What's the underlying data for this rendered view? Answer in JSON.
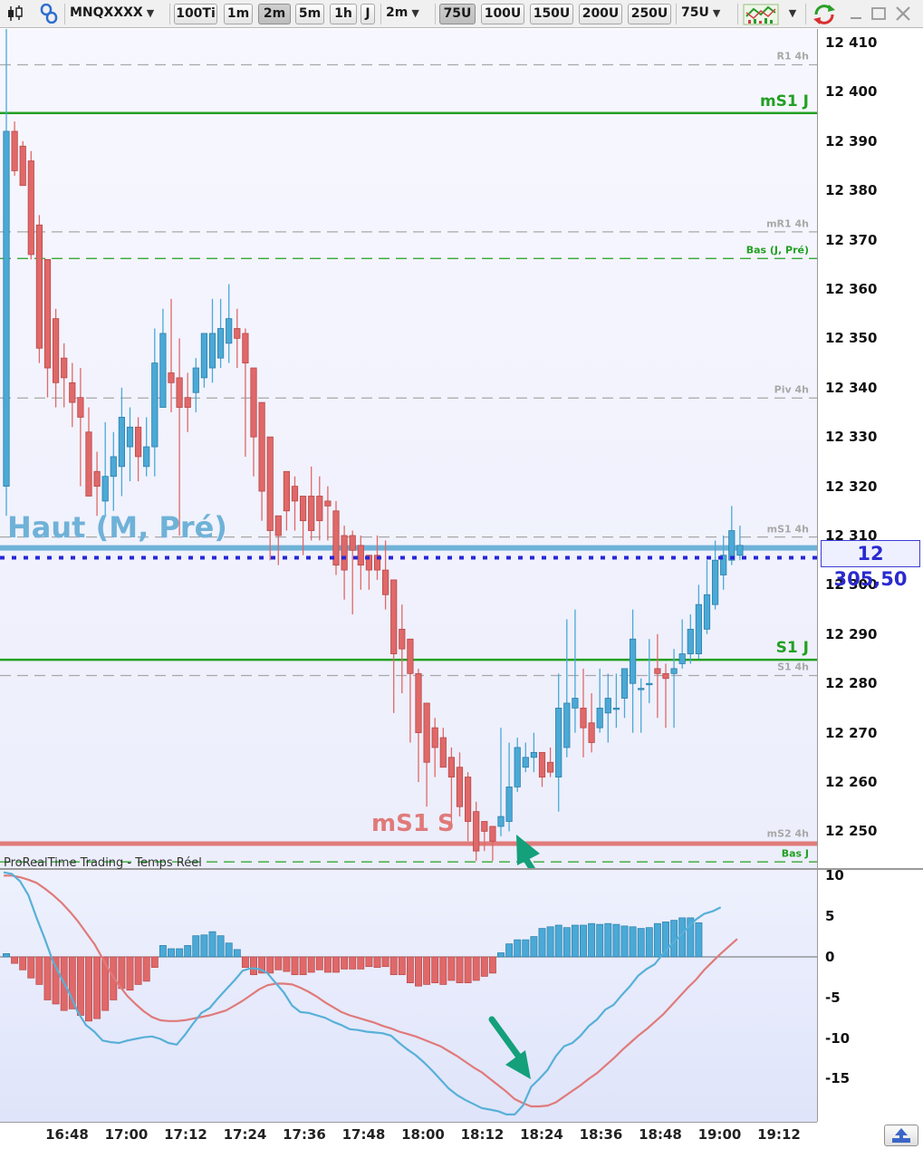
{
  "toolbar": {
    "symbol": "MNQXXXX",
    "tick_btn": "100Ti",
    "timeframes": [
      "1m",
      "2m",
      "5m",
      "1h",
      "J"
    ],
    "active_timeframe": "2m",
    "interval_select": "2m",
    "units": [
      "75U",
      "100U",
      "150U",
      "200U",
      "250U"
    ],
    "active_unit": "75U",
    "units_select": "75U"
  },
  "price_axis": {
    "labels": [
      "12 410",
      "12 400",
      "12 390",
      "12 380",
      "12 370",
      "12 360",
      "12 350",
      "12 340",
      "12 330",
      "12 320",
      "12 310",
      "12 300",
      "12 290",
      "12 280",
      "12 270",
      "12 260",
      "12 250"
    ],
    "values": [
      12410,
      12400,
      12390,
      12380,
      12370,
      12360,
      12350,
      12340,
      12330,
      12320,
      12310,
      12300,
      12290,
      12280,
      12270,
      12260,
      12250
    ],
    "last_price": "12 305,50"
  },
  "levels": [
    {
      "label": "R1 4h",
      "value": 12405.5,
      "style": "dashed",
      "color": "#a8a8a8"
    },
    {
      "label": "mS1 J",
      "value": 12395.7,
      "style": "solid",
      "color": "#22a022"
    },
    {
      "label": "mR1 4h",
      "value": 12371.6,
      "style": "dashed",
      "color": "#a8a8a8"
    },
    {
      "label": "Bas (J, Pré)",
      "value": 12366.2,
      "style": "dashed",
      "color": "#22a022"
    },
    {
      "label": "Piv 4h",
      "value": 12337.9,
      "style": "dashed",
      "color": "#a8a8a8"
    },
    {
      "label": "mS1 4h",
      "value": 12309.7,
      "style": "dashed",
      "color": "#a8a8a8"
    },
    {
      "label": "S1 J",
      "value": 12284.8,
      "style": "solid",
      "color": "#22a022"
    },
    {
      "label": "S1 4h",
      "value": 12281.6,
      "style": "dashed",
      "color": "#a8a8a8"
    },
    {
      "label": "mS2 4h",
      "value": 12247.8,
      "style": "dashed",
      "color": "#a8a8a8"
    },
    {
      "label": "Bas J",
      "value": 12243.8,
      "style": "dashed",
      "color": "#22a022"
    }
  ],
  "annotations": {
    "haut_label": "Haut (M, Pré)",
    "haut_value": 12307.5,
    "ms1s_label": "mS1 S",
    "ms1s_value": 12247.5,
    "current_price_value": 12305.5
  },
  "indicator": {
    "title": "ProRealTime Trading - Temps Réel",
    "axis_labels": [
      "10",
      "5",
      "0",
      "-5",
      "-10",
      "-15"
    ],
    "axis_values": [
      10,
      5,
      0,
      -5,
      -10,
      -15
    ]
  },
  "time_axis": [
    "16:48",
    "17:00",
    "17:12",
    "17:24",
    "17:36",
    "17:48",
    "18:00",
    "18:12",
    "18:24",
    "18:36",
    "18:48",
    "19:00",
    "19:12"
  ],
  "colors": {
    "bull": "#4aa9d6",
    "bear": "#e06868",
    "level_green": "#22a022",
    "level_grey": "#a8a8a8",
    "haut_line": "#6fb2d8",
    "ms1s_line": "#e07a7a",
    "price_dots": "#2626d8",
    "arrow": "#14a07a"
  },
  "chart_data": {
    "type": "candlestick",
    "ylim": [
      12243,
      12413
    ],
    "candles": [
      {
        "o": 12320,
        "h": 12413,
        "l": 12314,
        "c": 12392
      },
      {
        "o": 12392,
        "h": 12394,
        "l": 12383,
        "c": 12384
      },
      {
        "o": 12389,
        "h": 12390,
        "l": 12381,
        "c": 12381
      },
      {
        "o": 12386,
        "h": 12388,
        "l": 12366,
        "c": 12367
      },
      {
        "o": 12373,
        "h": 12375,
        "l": 12345,
        "c": 12348
      },
      {
        "o": 12366,
        "h": 12366,
        "l": 12338,
        "c": 12344
      },
      {
        "o": 12354,
        "h": 12356,
        "l": 12336,
        "c": 12341
      },
      {
        "o": 12346,
        "h": 12349,
        "l": 12336,
        "c": 12342
      },
      {
        "o": 12341,
        "h": 12345,
        "l": 12332,
        "c": 12337
      },
      {
        "o": 12338,
        "h": 12344,
        "l": 12320,
        "c": 12334
      },
      {
        "o": 12331,
        "h": 12336,
        "l": 12318,
        "c": 12318
      },
      {
        "o": 12323,
        "h": 12327,
        "l": 12314,
        "c": 12320
      },
      {
        "o": 12317,
        "h": 12333,
        "l": 12314,
        "c": 12322
      },
      {
        "o": 12322,
        "h": 12331,
        "l": 12315,
        "c": 12326
      },
      {
        "o": 12324,
        "h": 12340,
        "l": 12318,
        "c": 12334
      },
      {
        "o": 12328,
        "h": 12336,
        "l": 12321,
        "c": 12332
      },
      {
        "o": 12332,
        "h": 12334,
        "l": 12321,
        "c": 12326
      },
      {
        "o": 12324,
        "h": 12334,
        "l": 12322,
        "c": 12328
      },
      {
        "o": 12328,
        "h": 12352,
        "l": 12322,
        "c": 12345
      },
      {
        "o": 12336,
        "h": 12356,
        "l": 12336,
        "c": 12351
      },
      {
        "o": 12343,
        "h": 12358,
        "l": 12335,
        "c": 12341
      },
      {
        "o": 12342,
        "h": 12350,
        "l": 12310,
        "c": 12336
      },
      {
        "o": 12338,
        "h": 12343,
        "l": 12331,
        "c": 12336
      },
      {
        "o": 12339,
        "h": 12346,
        "l": 12335,
        "c": 12344
      },
      {
        "o": 12342,
        "h": 12350,
        "l": 12340,
        "c": 12351
      },
      {
        "o": 12344,
        "h": 12358,
        "l": 12341,
        "c": 12351
      },
      {
        "o": 12346,
        "h": 12358,
        "l": 12344,
        "c": 12352
      },
      {
        "o": 12349,
        "h": 12361,
        "l": 12345,
        "c": 12354
      },
      {
        "o": 12352,
        "h": 12356,
        "l": 12344,
        "c": 12350
      },
      {
        "o": 12351,
        "h": 12352,
        "l": 12326,
        "c": 12345
      },
      {
        "o": 12344,
        "h": 12344,
        "l": 12322,
        "c": 12330
      },
      {
        "o": 12337,
        "h": 12336,
        "l": 12313,
        "c": 12319
      },
      {
        "o": 12330,
        "h": 12330,
        "l": 12305,
        "c": 12311
      },
      {
        "o": 12314,
        "h": 12314,
        "l": 12304,
        "c": 12310
      },
      {
        "o": 12323,
        "h": 12323,
        "l": 12311,
        "c": 12315
      },
      {
        "o": 12320,
        "h": 12322,
        "l": 12311,
        "c": 12317
      },
      {
        "o": 12318,
        "h": 12318,
        "l": 12306,
        "c": 12313
      },
      {
        "o": 12318,
        "h": 12324,
        "l": 12309,
        "c": 12311
      },
      {
        "o": 12318,
        "h": 12322,
        "l": 12309,
        "c": 12313
      },
      {
        "o": 12317,
        "h": 12320,
        "l": 12309,
        "c": 12316
      },
      {
        "o": 12315,
        "h": 12317,
        "l": 12302,
        "c": 12304
      },
      {
        "o": 12310,
        "h": 12312,
        "l": 12297,
        "c": 12303
      },
      {
        "o": 12310,
        "h": 12311,
        "l": 12294,
        "c": 12307
      },
      {
        "o": 12308,
        "h": 12310,
        "l": 12299,
        "c": 12304
      },
      {
        "o": 12306,
        "h": 12306,
        "l": 12299,
        "c": 12303
      },
      {
        "o": 12306,
        "h": 12310,
        "l": 12301,
        "c": 12303
      },
      {
        "o": 12303,
        "h": 12309,
        "l": 12295,
        "c": 12298
      },
      {
        "o": 12301,
        "h": 12301,
        "l": 12274,
        "c": 12286
      },
      {
        "o": 12291,
        "h": 12296,
        "l": 12278,
        "c": 12287
      },
      {
        "o": 12289,
        "h": 12289,
        "l": 12268,
        "c": 12282
      },
      {
        "o": 12282,
        "h": 12283,
        "l": 12260,
        "c": 12270
      },
      {
        "o": 12276,
        "h": 12276,
        "l": 12255,
        "c": 12264
      },
      {
        "o": 12271,
        "h": 12273,
        "l": 12261,
        "c": 12267
      },
      {
        "o": 12269,
        "h": 12271,
        "l": 12263,
        "c": 12263
      },
      {
        "o": 12265,
        "h": 12267,
        "l": 12251,
        "c": 12261
      },
      {
        "o": 12263,
        "h": 12266,
        "l": 12253,
        "c": 12255
      },
      {
        "o": 12261,
        "h": 12262,
        "l": 12248,
        "c": 12252
      },
      {
        "o": 12254,
        "h": 12256,
        "l": 12244,
        "c": 12246
      },
      {
        "o": 12252,
        "h": 12252,
        "l": 12246,
        "c": 12250
      },
      {
        "o": 12251,
        "h": 12251,
        "l": 12244,
        "c": 12248
      },
      {
        "o": 12251,
        "h": 12271,
        "l": 12249,
        "c": 12253
      },
      {
        "o": 12252,
        "h": 12268,
        "l": 12250,
        "c": 12259
      },
      {
        "o": 12259,
        "h": 12269,
        "l": 12258,
        "c": 12267
      },
      {
        "o": 12263,
        "h": 12268,
        "l": 12262,
        "c": 12265
      },
      {
        "o": 12265,
        "h": 12270,
        "l": 12262,
        "c": 12266
      },
      {
        "o": 12266,
        "h": 12265,
        "l": 12259,
        "c": 12261
      },
      {
        "o": 12264,
        "h": 12267,
        "l": 12261,
        "c": 12262
      },
      {
        "o": 12261,
        "h": 12282,
        "l": 12254,
        "c": 12275
      },
      {
        "o": 12267,
        "h": 12293,
        "l": 12265,
        "c": 12276
      },
      {
        "o": 12275,
        "h": 12295,
        "l": 12270,
        "c": 12277
      },
      {
        "o": 12275,
        "h": 12283,
        "l": 12265,
        "c": 12271
      },
      {
        "o": 12272,
        "h": 12278,
        "l": 12266,
        "c": 12268
      },
      {
        "o": 12271,
        "h": 12283,
        "l": 12270,
        "c": 12275
      },
      {
        "o": 12274,
        "h": 12282,
        "l": 12268,
        "c": 12277
      },
      {
        "o": 12275,
        "h": 12282,
        "l": 12271,
        "c": 12275
      },
      {
        "o": 12277,
        "h": 12283,
        "l": 12273,
        "c": 12283
      },
      {
        "o": 12280,
        "h": 12295,
        "l": 12270,
        "c": 12289
      },
      {
        "o": 12279,
        "h": 12281,
        "l": 12270,
        "c": 12279
      },
      {
        "o": 12280,
        "h": 12289,
        "l": 12276,
        "c": 12280
      },
      {
        "o": 12283,
        "h": 12290,
        "l": 12273,
        "c": 12282
      },
      {
        "o": 12282,
        "h": 12284,
        "l": 12271,
        "c": 12281
      },
      {
        "o": 12282,
        "h": 12287,
        "l": 12271,
        "c": 12283
      },
      {
        "o": 12284,
        "h": 12293,
        "l": 12283,
        "c": 12286
      },
      {
        "o": 12286,
        "h": 12294,
        "l": 12284,
        "c": 12291
      },
      {
        "o": 12286,
        "h": 12300,
        "l": 12285,
        "c": 12296
      },
      {
        "o": 12291,
        "h": 12305,
        "l": 12290,
        "c": 12298
      },
      {
        "o": 12296,
        "h": 12309,
        "l": 12295,
        "c": 12305
      },
      {
        "o": 12302,
        "h": 12310,
        "l": 12299,
        "c": 12306
      },
      {
        "o": 12305,
        "h": 12316,
        "l": 12304,
        "c": 12311
      },
      {
        "o": 12306,
        "h": 12312,
        "l": 12305,
        "c": 12308
      }
    ],
    "histogram": [
      0.4,
      -0.8,
      -1.6,
      -2.6,
      -3.4,
      -5.3,
      -5.8,
      -6.6,
      -6.4,
      -7.2,
      -7.9,
      -7.6,
      -6.6,
      -5.3,
      -3.9,
      -4.1,
      -3.4,
      -3.0,
      -1.3,
      1.4,
      1.0,
      1.0,
      1.4,
      2.6,
      2.7,
      3.1,
      2.6,
      1.7,
      0.9,
      -1.3,
      -2.2,
      -2.0,
      -2.0,
      -1.6,
      -1.8,
      -2.2,
      -2.2,
      -1.9,
      -1.6,
      -1.9,
      -1.9,
      -1.5,
      -1.5,
      -1.5,
      -1.2,
      -1.3,
      -1.2,
      -2.2,
      -2.2,
      -3.2,
      -3.6,
      -3.4,
      -3.2,
      -3.4,
      -2.9,
      -3.2,
      -3.2,
      -2.9,
      -2.4,
      -2.0,
      0.5,
      1.6,
      2.1,
      2.1,
      2.5,
      3.5,
      3.7,
      3.9,
      3.6,
      3.9,
      3.9,
      4.1,
      4.0,
      4.1,
      4.0,
      3.8,
      3.7,
      3.5,
      3.6,
      4.1,
      4.3,
      4.5,
      4.8,
      4.8,
      4.2
    ],
    "macd_line": [
      10.4,
      10.2,
      9.3,
      7.6,
      4.8,
      2.2,
      -0.6,
      -2.6,
      -4.5,
      -6.8,
      -8.4,
      -9.2,
      -10.3,
      -10.5,
      -10.6,
      -10.3,
      -10.1,
      -9.9,
      -9.8,
      -10.1,
      -10.6,
      -10.8,
      -9.6,
      -8.2,
      -6.9,
      -6.3,
      -5.1,
      -4.0,
      -2.9,
      -1.7,
      -1.4,
      -1.5,
      -2.0,
      -3.2,
      -4.4,
      -6.0,
      -6.8,
      -6.9,
      -7.2,
      -7.5,
      -8.0,
      -8.4,
      -8.9,
      -9.0,
      -9.2,
      -9.3,
      -9.4,
      -9.7,
      -10.6,
      -11.4,
      -12.1,
      -13.0,
      -14.0,
      -15.1,
      -16.2,
      -17.0,
      -17.6,
      -18.1,
      -18.6,
      -18.8,
      -19.0,
      -19.4,
      -19.4,
      -18.3,
      -16.0,
      -15.0,
      -13.9,
      -12.2,
      -11.0,
      -10.6,
      -9.7,
      -8.5,
      -7.7,
      -6.5,
      -5.9,
      -4.7,
      -3.6,
      -2.3,
      -1.5,
      -0.9,
      0.4,
      1.5,
      2.5,
      3.6,
      4.6,
      5.3,
      5.6,
      6.1
    ],
    "signal_line": [
      10.0,
      10.0,
      9.8,
      9.5,
      9.1,
      8.4,
      7.6,
      6.7,
      5.6,
      4.4,
      3.0,
      1.6,
      -0.2,
      -2.0,
      -3.5,
      -4.8,
      -5.8,
      -6.7,
      -7.4,
      -7.8,
      -7.9,
      -7.9,
      -7.8,
      -7.6,
      -7.4,
      -7.2,
      -6.9,
      -6.6,
      -6.0,
      -5.4,
      -4.7,
      -4.0,
      -3.5,
      -3.3,
      -3.3,
      -3.4,
      -3.8,
      -4.3,
      -4.9,
      -5.6,
      -6.2,
      -6.8,
      -7.2,
      -7.5,
      -7.8,
      -8.1,
      -8.5,
      -8.8,
      -9.2,
      -9.5,
      -9.8,
      -10.2,
      -10.6,
      -11.0,
      -11.6,
      -12.2,
      -12.9,
      -13.6,
      -14.2,
      -15.0,
      -15.8,
      -16.6,
      -17.5,
      -18.0,
      -18.4,
      -18.4,
      -18.3,
      -17.9,
      -17.2,
      -16.5,
      -15.8,
      -15.0,
      -14.3,
      -13.4,
      -12.5,
      -11.5,
      -10.6,
      -9.7,
      -8.9,
      -8.0,
      -7.1,
      -6.0,
      -4.9,
      -3.8,
      -2.8,
      -1.6,
      -0.6,
      0.4,
      1.3,
      2.2
    ],
    "indicator_ylim": [
      -20.3,
      10.7
    ]
  }
}
